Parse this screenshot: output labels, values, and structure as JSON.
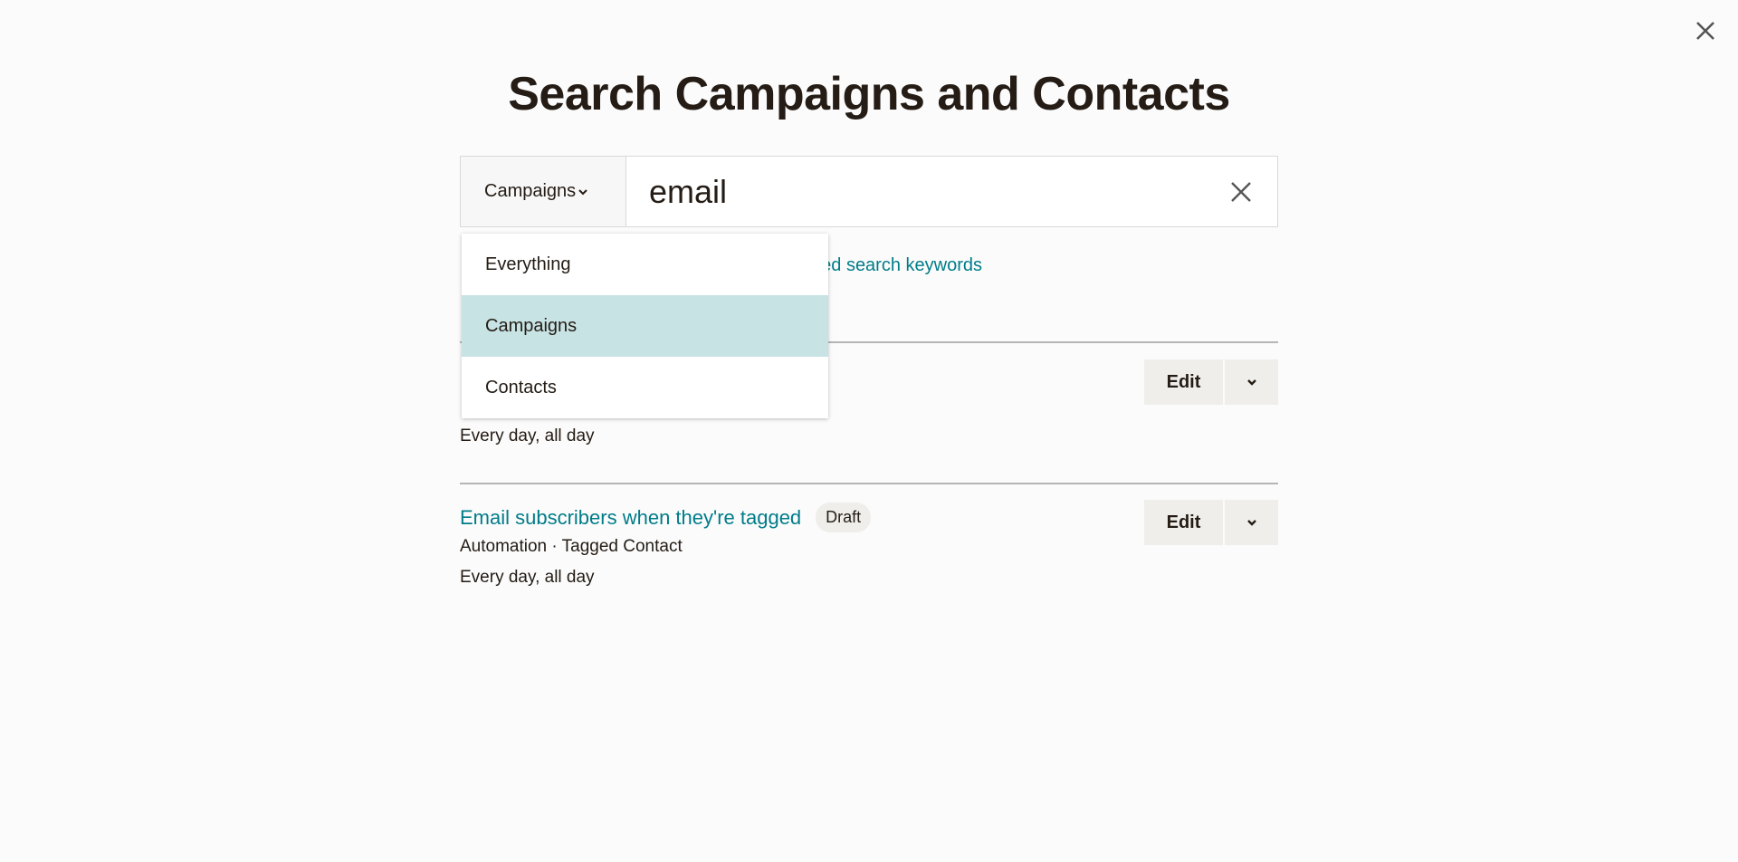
{
  "header": {
    "title": "Search Campaigns and Contacts",
    "close_icon": "close-icon"
  },
  "search": {
    "scope_selected": "Campaigns",
    "query": "email",
    "clear_icon": "close-icon"
  },
  "help_link": "Learn about advanced search keywords",
  "scope_menu": {
    "items": [
      {
        "label": "Everything",
        "selected": false
      },
      {
        "label": "Campaigns",
        "selected": true
      },
      {
        "label": "Contacts",
        "selected": false
      }
    ]
  },
  "results": [
    {
      "schedule": "Every day, all day",
      "edit_label": "Edit"
    },
    {
      "title": "Email subscribers when they're tagged",
      "status": "Draft",
      "meta": "Automation · Tagged Contact",
      "schedule": "Every day, all day",
      "edit_label": "Edit"
    }
  ],
  "colors": {
    "accent": "#007c89",
    "selected_bg": "#c7e3e4",
    "button_bg": "#efeeea"
  }
}
